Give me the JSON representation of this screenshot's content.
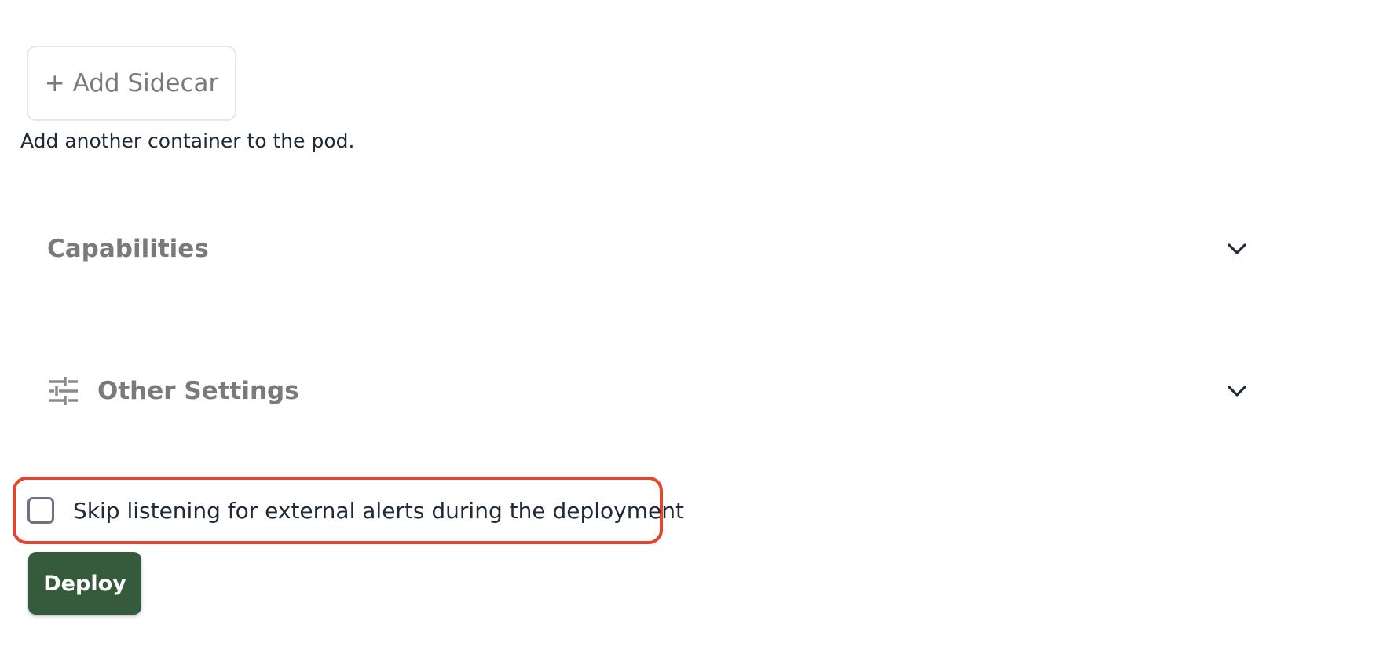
{
  "sidecar": {
    "button_label": "+ Add Sidecar",
    "help_text": "Add another container to the pod."
  },
  "sections": {
    "capabilities": {
      "title": "Capabilities",
      "icon": "chevron-down-icon"
    },
    "other_settings": {
      "title": "Other Settings",
      "icon": "sliders-icon",
      "toggle_icon": "chevron-down-icon"
    }
  },
  "alerts": {
    "checkbox_label": "Skip listening for external alerts during the deployment",
    "checked": false
  },
  "actions": {
    "deploy_label": "Deploy"
  },
  "colors": {
    "deploy_button": "#355a3c",
    "highlight_border": "#e8432d",
    "muted_text": "#7a7a7a"
  }
}
